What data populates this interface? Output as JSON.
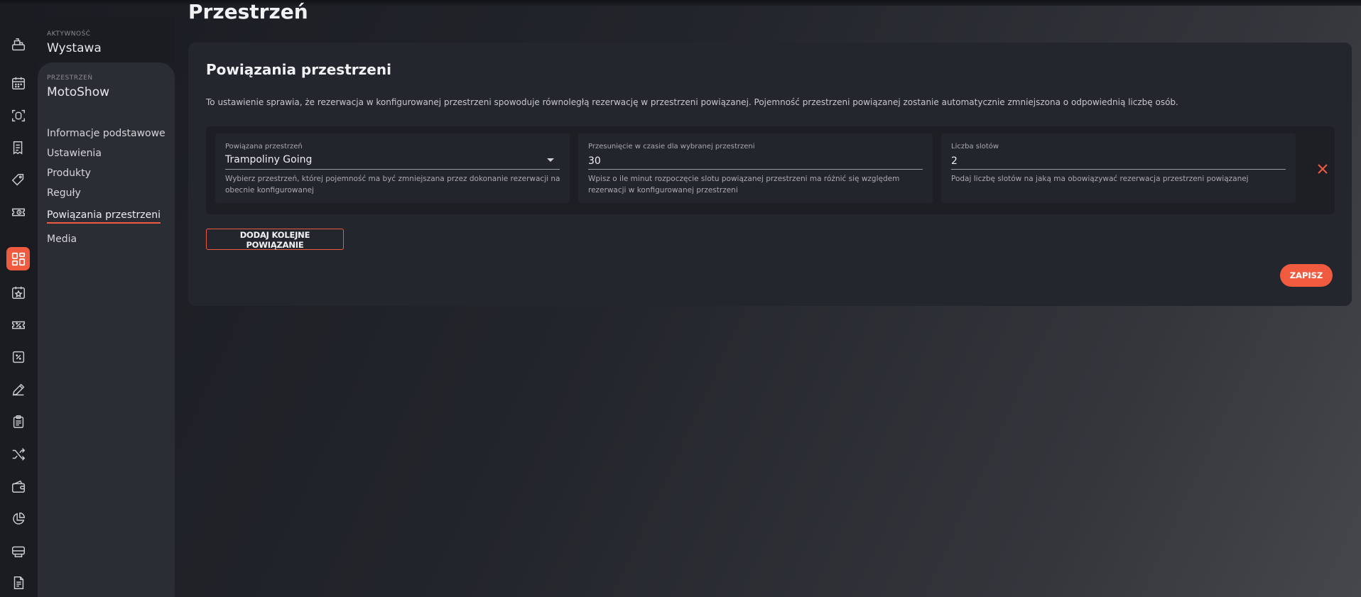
{
  "page": {
    "title": "Przestrzeń"
  },
  "rail": {
    "active_index": 6,
    "icons": [
      "cash-register-icon",
      "calendar-icon",
      "scan-icon",
      "receipt-icon",
      "tag-icon",
      "history-ticket-icon",
      "dashboard-grid-icon",
      "star-calendar-icon",
      "ticket-percent-icon",
      "percent-box-icon",
      "pencil-icon",
      "clipboard-icon",
      "shuffle-icon",
      "wallet-icon",
      "pie-chart-icon",
      "printer-icon",
      "document-icon"
    ]
  },
  "sidebar": {
    "activity_caption": "AKTYWNOŚĆ",
    "activity_value": "Wystawa",
    "space_caption": "PRZESTRZEŃ",
    "space_value": "MotoShow",
    "items": [
      {
        "label": "Informacje podstawowe"
      },
      {
        "label": "Ustawienia"
      },
      {
        "label": "Produkty"
      },
      {
        "label": "Reguły"
      },
      {
        "label": "Powiązania przestrzeni"
      },
      {
        "label": "Media"
      }
    ],
    "active_item": "Powiązania przestrzeni"
  },
  "card": {
    "title": "Powiązania przestrzeni",
    "description": "To ustawienie sprawia, że rezerwacja w konfigurowanej przestrzeni spowoduje równoległą rezerwację w przestrzeni powiązanej. Pojemność przestrzeni powiązanej zostanie automatycznie zmniejszona o odpowiednią liczbę osób.",
    "fields": {
      "space": {
        "label": "Powiązana przestrzeń",
        "value": "Trampoliny Going",
        "help": "Wybierz przestrzeń, której pojemność ma być zmniejszana przez dokonanie rezerwacji na obecnie konfigurowanej"
      },
      "offset": {
        "label": "Przesunięcie w czasie dla wybranej przestrzeni",
        "value": "30",
        "help": "Wpisz o ile minut rozpoczęcie slotu powiązanej przestrzeni ma różnić się względem rezerwacji w konfigurowanej przestrzeni"
      },
      "slots": {
        "label": "Liczba slotów",
        "value": "2",
        "help": "Podaj liczbę slotów na jaką ma obowiązywać rezerwacja przestrzeni powiązanej"
      }
    },
    "add_label": "DODAJ KOLEJNE POWIĄZANIE",
    "save_label": "ZAPISZ"
  },
  "colors": {
    "accent": "#f05a3e",
    "card": "#24262d",
    "sidebar": "#2b2d34",
    "rail": "#1a1c21"
  }
}
